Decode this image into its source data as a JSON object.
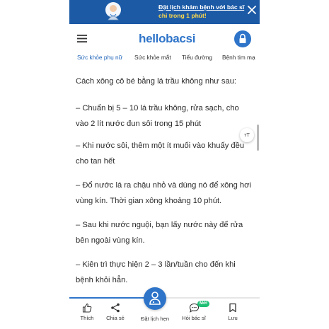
{
  "promo": {
    "line1": "Đặt lịch khám bệnh với bác sĩ",
    "line2": "chỉ trong 1 phút!"
  },
  "header": {
    "logo_part1": "hello",
    "logo_part2": "bacsi"
  },
  "tabs": [
    {
      "label": "Sức khỏe phụ nữ",
      "active": true
    },
    {
      "label": "Sức khỏe mắt",
      "active": false
    },
    {
      "label": "Tiểu đường",
      "active": false
    },
    {
      "label": "Bệnh tim mạ",
      "active": false
    }
  ],
  "article": {
    "paragraphs": [
      "Cách xông cô bé bằng lá trầu không như sau:",
      "– Chuẩn bị 5 – 10 lá trầu không, rửa sạch, cho vào 2 lít nước đun sôi trong 15 phút",
      "– Khi nước sôi, thêm một ít muối vào khuấy đều cho tan hết",
      "– Đổ nước lá ra chậu nhỏ và dùng nó để xông hơi vùng kín. Thời gian xông khoảng 10 phút.",
      "– Sau khi nước nguội, bạn lấy nước này để rửa bên ngoài vùng kín.",
      "– Kiên trì thực hiện 2 – 3 lần/tuần cho đến khi bệnh khỏi hẳn."
    ],
    "text_size_label": "тT"
  },
  "bottom_bar": {
    "items": [
      {
        "label": "Thích",
        "icon": "thumbs-up-icon"
      },
      {
        "label": "Chia sẻ",
        "icon": "share-icon"
      },
      {
        "label": "Đặt lịch hẹn",
        "icon": "doctor-icon"
      },
      {
        "label": "Hỏi bác sĩ",
        "icon": "chat-icon"
      },
      {
        "label": "Lưu",
        "icon": "bookmark-icon"
      }
    ],
    "new_badge": "Mới",
    "reading_progress": 0.5
  },
  "colors": {
    "brand_blue": "#2e74c9",
    "promo_bg": "#1c5aa6",
    "promo_highlight": "#ffd84a",
    "badge_green": "#1dbf73"
  }
}
